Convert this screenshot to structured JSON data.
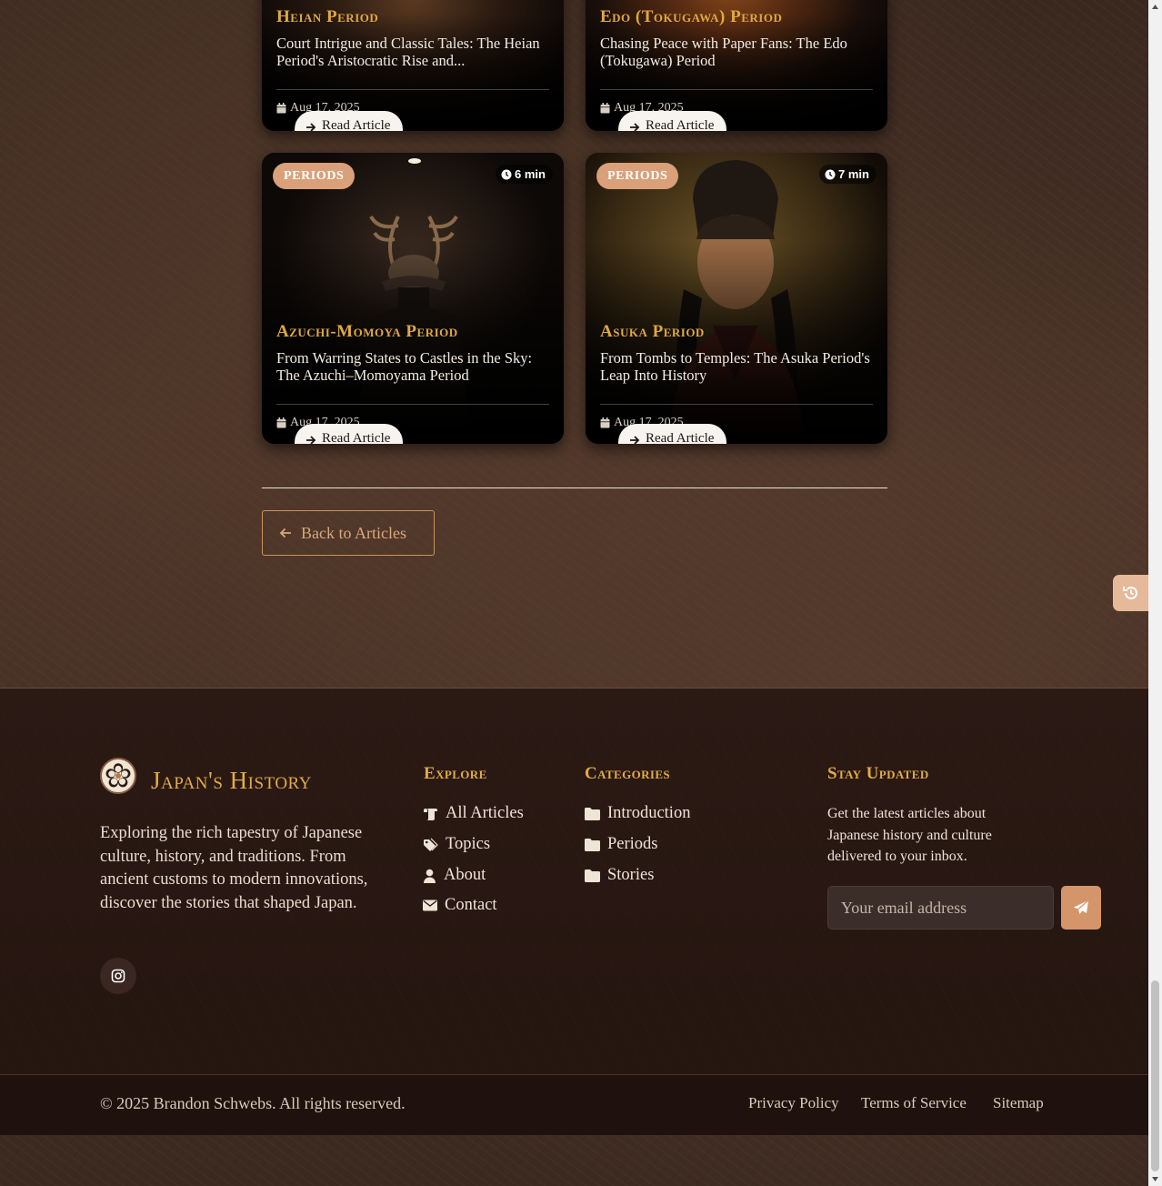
{
  "cards": [
    {
      "period": "Heian Period",
      "title": "Court Intrigue and Classic Tales: The Heian Period's Aristocratic Rise and...",
      "date": "Aug 17, 2025",
      "read_label": "Read Article"
    },
    {
      "period": "Edo (Tokugawa) Period",
      "title": "Chasing Peace with Paper Fans: The Edo (Tokugawa) Period",
      "date": "Aug 17, 2025",
      "read_label": "Read Article"
    },
    {
      "badge": "PERIODS",
      "read_time": "6 min",
      "period": "Azuchi-Momoya Period",
      "title": "From Warring States to Castles in the Sky: The Azuchi–Momoyama Period",
      "date": "Aug 17, 2025",
      "read_label": "Read Article"
    },
    {
      "badge": "PERIODS",
      "read_time": "7 min",
      "period": "Asuka Period",
      "title": "From Tombs to Temples: The Asuka Period's Leap Into History",
      "date": "Aug 17, 2025",
      "read_label": "Read Article"
    }
  ],
  "back_button": "Back to Articles",
  "footer": {
    "brand": "Japan's History",
    "about": "Exploring the rich tapestry of Japanese culture, history, and traditions. From ancient customs to modern innovations, discover the stories that shaped Japan.",
    "explore": {
      "heading": "Explore",
      "links": [
        "All Articles",
        "Topics",
        "About",
        "Contact"
      ]
    },
    "categories": {
      "heading": "Categories",
      "links": [
        "Introduction",
        "Periods",
        "Stories"
      ]
    },
    "newsletter": {
      "heading": "Stay Updated",
      "text": "Get the latest articles about Japanese history and culture delivered to your inbox.",
      "placeholder": "Your email address"
    },
    "copyright": "© 2025 Brandon Schwebs. All rights reserved.",
    "legal_links": [
      "Privacy Policy",
      "Terms of Service",
      "Sitemap"
    ]
  },
  "colors": {
    "accent_gold": "#e0ad45",
    "badge": "#d9a07a",
    "button_copper": "#d4956b",
    "footer_bg": "#281713"
  },
  "icons": [
    "calendar-icon",
    "arrow-right-icon",
    "clock-icon",
    "arrow-left-icon",
    "history-icon",
    "scroll-icon",
    "tags-icon",
    "user-icon",
    "envelope-icon",
    "folder-icon",
    "instagram-icon",
    "paper-plane-icon"
  ]
}
